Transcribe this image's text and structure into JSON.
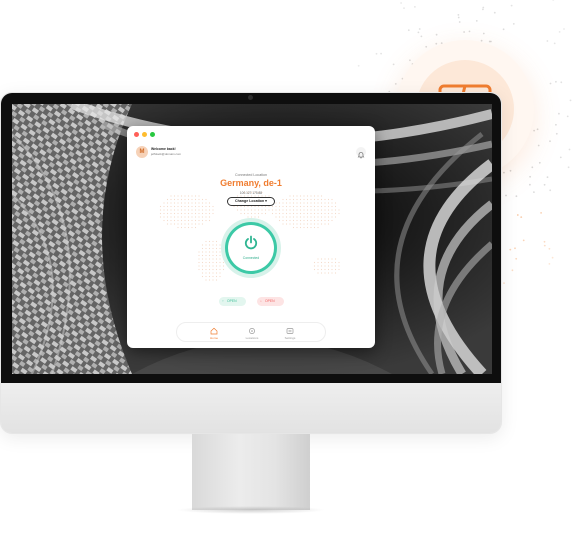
{
  "app": {
    "user_initial": "M",
    "welcome": "Welcome back!",
    "email": "jeffslack@domain.com",
    "connected_label": "Connected Location",
    "location": "Germany, de-1",
    "ip_address": "100.127.175.88",
    "change_location_label": "Change Location",
    "status": "Connected",
    "upload_label": "OPEN",
    "download_label": "OPEN",
    "nav": [
      {
        "label": "Home",
        "icon": "home-icon",
        "active": true
      },
      {
        "label": "Locations",
        "icon": "location-icon",
        "active": false
      },
      {
        "label": "Settings",
        "icon": "settings-icon",
        "active": false
      }
    ]
  },
  "badge_icon": "finder-icon",
  "colors": {
    "accent": "#f07d30",
    "connected": "#3cc9a6",
    "download": "#f06060"
  }
}
